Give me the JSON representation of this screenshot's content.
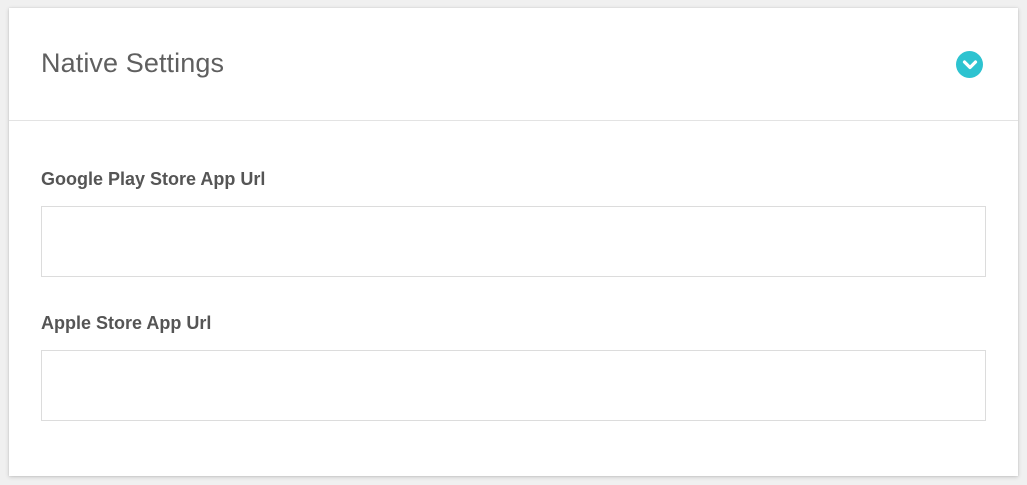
{
  "panel": {
    "title": "Native Settings",
    "toggle_icon": "chevron-down-circle-icon",
    "accent_color": "#2dc3d0"
  },
  "fields": {
    "google_play": {
      "label": "Google Play Store App Url",
      "value": "",
      "placeholder": ""
    },
    "apple_store": {
      "label": "Apple Store App Url",
      "value": "",
      "placeholder": ""
    }
  }
}
